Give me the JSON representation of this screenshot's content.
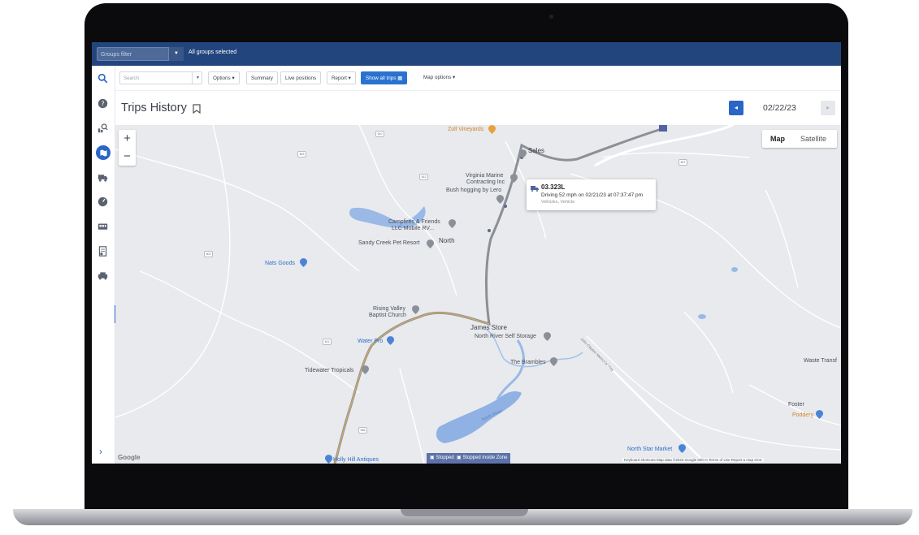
{
  "header": {
    "groups_filter_placeholder": "Groups filter",
    "groups_selected": "All groups selected"
  },
  "rail": {
    "icons": [
      "search-icon",
      "help-icon",
      "map-search-icon",
      "trips-history-icon",
      "vehicle-icon",
      "gauge-icon",
      "bus-icon",
      "report-icon",
      "exceptions-icon"
    ],
    "active_color": "#2a66c6"
  },
  "toolbar": {
    "search_placeholder": "Search",
    "options_label": "Options",
    "summary_label": "Summary",
    "live_positions_label": "Live positions",
    "report_label": "Report",
    "show_all_trips_label": "Show all trips",
    "map_options_label": "Map options"
  },
  "page": {
    "title": "Trips History",
    "date": "02/22/23"
  },
  "map": {
    "map_type_map": "Map",
    "map_type_satellite": "Satellite",
    "zoom_in": "+",
    "zoom_out": "−",
    "labels": {
      "zoll_vineyards": "Zoll Vineyards",
      "sales": "Sales",
      "virginia_marine": "Virginia Marine",
      "contracting": "Contracting Inc",
      "bush_hogging": "Bush hogging by Lero",
      "campfires": "Campfires & Friends",
      "llc_mobile": "LLC Mobile RV...",
      "sandy_creek": "Sandy Creek Pet Resort",
      "north": "North",
      "nats_goods": "Nats Goods",
      "rising_valley": "Rising Valley",
      "baptist_church": "Baptist Church",
      "james_store": "James Store",
      "north_river_self_storage": "North River Self Storage",
      "water_pro": "Water Pro",
      "the_brambles": "The Brambles",
      "tidewater_tropicals": "Tidewater Tropicals",
      "waste_transf": "Waste Transf",
      "foster": "Foster",
      "poddery": "Poddery",
      "north_star_market": "North Star Market",
      "holly_hill_antiques": "Holly Hill Antiques",
      "north_river": "North River",
      "john_clayton_road": "John Clayton Memorial Hwy"
    },
    "popup": {
      "vehicle": "03.323L",
      "status": "Driving 52 mph on 02/21/23 at 07:37:47 pm",
      "group": "Vehicles, Vehicle"
    },
    "legend": {
      "stopped": "Stopped",
      "stopped_inside_zone": "Stopped inside Zone"
    },
    "attribution": "Keyboard shortcuts    Map data ©2023 Google    500 m            Terms of Use    Report a map error",
    "google": "Google",
    "route_color": "#8c8f94",
    "route_highlight_color": "#c9a86a",
    "water_color": "#7aa3dd"
  }
}
